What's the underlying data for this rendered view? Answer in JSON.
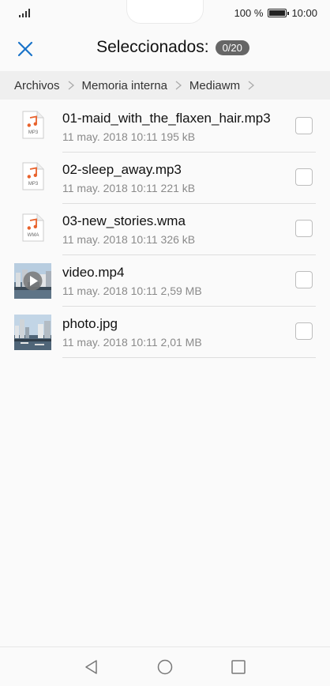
{
  "status_bar": {
    "battery_percent": "100 %",
    "time": "10:00"
  },
  "header": {
    "title": "Seleccionados:",
    "selection_count": "0/20"
  },
  "breadcrumb": {
    "items": [
      "Archivos",
      "Memoria interna",
      "Mediawm"
    ]
  },
  "files": [
    {
      "name": "01-maid_with_the_flaxen_hair.mp3",
      "meta": "11 may. 2018 10:11 195 kB",
      "type": "MP3",
      "icon": "audio-file-icon"
    },
    {
      "name": "02-sleep_away.mp3",
      "meta": "11 may. 2018 10:11 221 kB",
      "type": "MP3",
      "icon": "audio-file-icon"
    },
    {
      "name": "03-new_stories.wma",
      "meta": "11 may. 2018 10:11 326 kB",
      "type": "WMA",
      "icon": "audio-file-icon"
    },
    {
      "name": "video.mp4",
      "meta": "11 may. 2018 10:11 2,59 MB",
      "type": "video",
      "icon": "video-thumbnail"
    },
    {
      "name": "photo.jpg",
      "meta": "11 may. 2018 10:11 2,01 MB",
      "type": "image",
      "icon": "image-thumbnail"
    }
  ],
  "colors": {
    "accent": "#1a73c9",
    "audio_icon": "#e8622c",
    "badge_bg": "#666666"
  }
}
